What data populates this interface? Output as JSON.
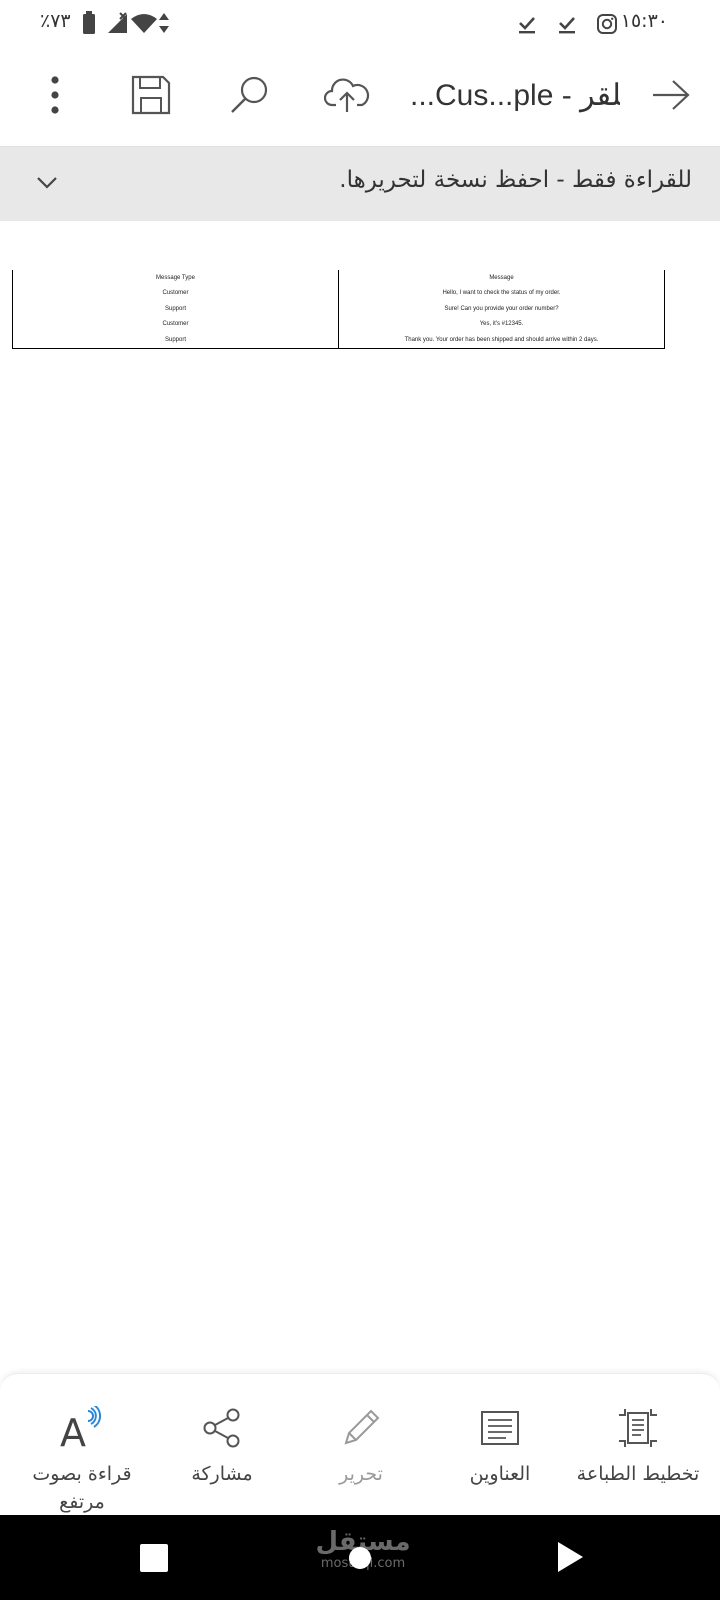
{
  "status_bar": {
    "time": "١٥:٣٠",
    "battery": "٪٧٣"
  },
  "toolbar": {
    "title": "...Cus...ple - للقر"
  },
  "banner": {
    "message": "للقراءة فقط - احفظ نسخة لتحريرها."
  },
  "document": {
    "table": {
      "headers": [
        "Message Type",
        "Message"
      ],
      "rows": [
        [
          "Customer",
          "Hello, I want to check the status of my order."
        ],
        [
          "Support",
          "Sure! Can you provide your order number?"
        ],
        [
          "Customer",
          "Yes, it's #12345."
        ],
        [
          "Support",
          "Thank you. Your order has been shipped and should arrive within 2 days."
        ]
      ]
    }
  },
  "bottom_bar": {
    "items": [
      {
        "label": "تخطيط الطباعة",
        "icon": "print-layout-icon"
      },
      {
        "label": "العناوين",
        "icon": "headings-icon"
      },
      {
        "label": "تحرير",
        "icon": "pencil-icon"
      },
      {
        "label": "مشاركة",
        "icon": "share-icon"
      },
      {
        "label": "قراءة بصوت مرتفع",
        "icon": "read-aloud-icon"
      }
    ]
  },
  "watermark": {
    "arabic": "مستقل",
    "latin": "mostaql.com"
  },
  "colors": {
    "banner_bg": "#e8e8e8",
    "read_aloud_accent": "#2b88d8",
    "disabled_text": "#9a9a9a"
  }
}
